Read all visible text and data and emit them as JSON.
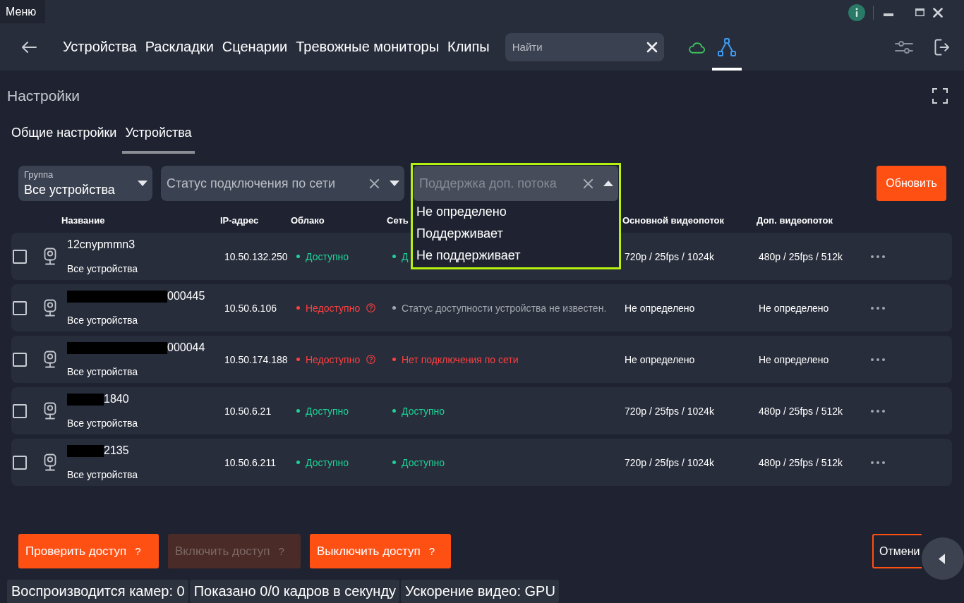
{
  "title_bar": {
    "menu": "Меню"
  },
  "nav": {
    "items": [
      "Устройства",
      "Раскладки",
      "Сценарии",
      "Тревожные мониторы",
      "Клипы"
    ],
    "search": {
      "placeholder": "Найти"
    },
    "icon_tabs": [
      {
        "kind": "cloud",
        "selected": false
      },
      {
        "kind": "network",
        "selected": true
      }
    ]
  },
  "page": {
    "title": "Настройки"
  },
  "tabs": [
    {
      "label": "Общие настройки",
      "selected": false
    },
    {
      "label": "Устройства",
      "selected": true
    }
  ],
  "filters": [
    {
      "kind": "select",
      "label": "Группа",
      "value": "Все устройства",
      "clearable": false,
      "expanded": false
    },
    {
      "kind": "select",
      "placeholder": "Статус подключения по сети",
      "clearable": true,
      "expanded": false
    },
    {
      "kind": "select",
      "placeholder": "Поддержка доп. потока",
      "clearable": true,
      "expanded": true,
      "options": [
        {
          "label": "Не определено",
          "selected": false
        },
        {
          "label": "Поддерживает",
          "selected": false
        },
        {
          "label": "Не поддерживает",
          "selected": false
        }
      ]
    }
  ],
  "refresh_button": "Обновить",
  "table": {
    "columns": [
      "Название",
      "IP-адрес",
      "Облако",
      "Сеть",
      "Основной видеопоток",
      "Доп. видеопоток"
    ],
    "rows": [
      {
        "kind": "plain",
        "checked": false,
        "name": "12cnypmmn3",
        "group": "Все устройства",
        "ip": "10.50.132.250",
        "cloud": {
          "text": "Доступно",
          "color": "#1ed296",
          "help": false
        },
        "network": {
          "text": "Д",
          "color": "#1ed296"
        },
        "main_stream": "720p / 25fps / 1024k",
        "sub_stream": "480p / 25fps / 512k"
      },
      {
        "kind": "redacted",
        "checked": false,
        "name": "000445",
        "group": "Все устройства",
        "ip": "10.50.6.106",
        "cloud": {
          "text": "Недоступно",
          "color": "#ff4040",
          "help": true
        },
        "network": {
          "text": "Статус доступности устройства не известен.",
          "color": "#a4a7ae"
        },
        "main_stream": "Не определено",
        "sub_stream": "Не определено"
      },
      {
        "kind": "redacted",
        "checked": false,
        "name": "000044",
        "group": "Все устройства",
        "ip": "10.50.174.188",
        "cloud": {
          "text": "Недоступно",
          "color": "#ff4040",
          "help": true
        },
        "network": {
          "text": "Нет подключения по сети",
          "color": "#ff4040"
        },
        "main_stream": "Не определено",
        "sub_stream": "Не определено"
      },
      {
        "kind": "redactedshort",
        "checked": false,
        "name": "1840",
        "group": "Все устройства",
        "ip": "10.50.6.21",
        "cloud": {
          "text": "Доступно",
          "color": "#1ed296",
          "help": false
        },
        "network": {
          "text": "Доступно",
          "color": "#1ed296"
        },
        "main_stream": "720p / 25fps / 1024k",
        "sub_stream": "480p / 25fps / 512k"
      },
      {
        "kind": "redactedshort",
        "checked": false,
        "name": "2135",
        "group": "Все устройства",
        "ip": "10.50.6.211",
        "cloud": {
          "text": "Доступно",
          "color": "#1ed296",
          "help": false
        },
        "network": {
          "text": "Доступно",
          "color": "#1ed296"
        },
        "main_stream": "720p / 25fps / 1024k",
        "sub_stream": "480p / 25fps / 512k"
      }
    ]
  },
  "actions": [
    {
      "label": "Проверить доступ",
      "hint": "?",
      "disabled": false
    },
    {
      "label": "Включить доступ",
      "hint": "?",
      "disabled": true
    },
    {
      "label": "Выключить доступ",
      "hint": "?",
      "disabled": false
    }
  ],
  "cancel_button": "Отмени",
  "status_bar": [
    "Воспроизводится камер: 0",
    "Показано 0/0 кадров в секунду",
    "Ускорение видео: GPU"
  ]
}
